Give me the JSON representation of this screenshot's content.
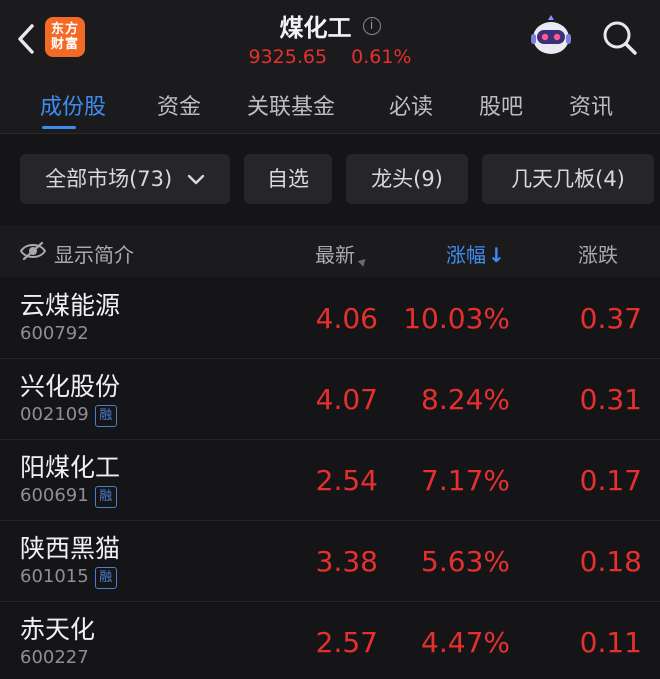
{
  "header": {
    "logo_line1": "东方",
    "logo_line2": "财富",
    "title": "煤化工",
    "info_icon": "i",
    "index_value": "9325.65",
    "index_change": "0.61%"
  },
  "tabs": [
    {
      "label": "成份股",
      "active": true
    },
    {
      "label": "资金"
    },
    {
      "label": "关联基金"
    },
    {
      "label": "必读"
    },
    {
      "label": "股吧"
    },
    {
      "label": "资讯"
    }
  ],
  "filters": {
    "market": "全部市场(73)",
    "watchlist": "自选",
    "leaders": "龙头(9)",
    "boards": "几天几板(4)"
  },
  "table": {
    "col_name": "显示简介",
    "col_price": "最新",
    "col_pct": "涨幅",
    "col_pct_arrow": "↓",
    "col_change": "涨跌",
    "rows": [
      {
        "name": "云煤能源",
        "code": "600792",
        "tag": "",
        "price": "4.06",
        "pct": "10.03%",
        "change": "0.37"
      },
      {
        "name": "兴化股份",
        "code": "002109",
        "tag": "融",
        "price": "4.07",
        "pct": "8.24%",
        "change": "0.31"
      },
      {
        "name": "阳煤化工",
        "code": "600691",
        "tag": "融",
        "price": "2.54",
        "pct": "7.17%",
        "change": "0.17"
      },
      {
        "name": "陕西黑猫",
        "code": "601015",
        "tag": "融",
        "price": "3.38",
        "pct": "5.63%",
        "change": "0.18"
      },
      {
        "name": "赤天化",
        "code": "600227",
        "tag": "",
        "price": "2.57",
        "pct": "4.47%",
        "change": "0.11"
      }
    ]
  },
  "colors": {
    "up": "#e5302e",
    "accent": "#3f8cf0",
    "background": "#151518"
  }
}
